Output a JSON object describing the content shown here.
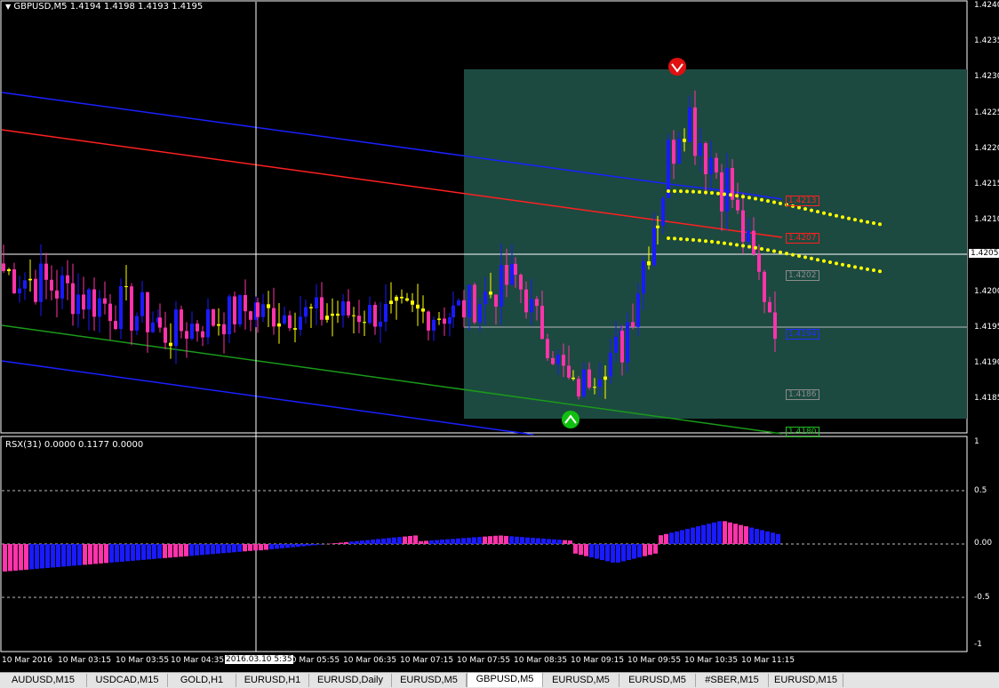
{
  "symbol_header": "GBPUSD,M5  1.4194 1.4198 1.4193 1.4195",
  "indicator_header": "RSX(31) 0.0000 0.1177 0.0000",
  "price_axis": [
    "1.4240",
    "1.4235",
    "1.4230",
    "1.4225",
    "1.4220",
    "1.4215",
    "1.4210",
    "1.4205",
    "1.4200",
    "1.4195",
    "1.4190",
    "1.4185"
  ],
  "current_price_label": "1.4205",
  "rsx_axis": [
    "1",
    "0.5",
    "0.00",
    "-0.5",
    "-1"
  ],
  "level_tags": [
    {
      "text": "1.4213",
      "color": "#ff2020"
    },
    {
      "text": "1.4207",
      "color": "#ff2020"
    },
    {
      "text": "1.4202",
      "color": "#8c8c8c"
    },
    {
      "text": "1.4194",
      "color": "#2030ff"
    },
    {
      "text": "1.4186",
      "color": "#8c8c8c"
    },
    {
      "text": "1.4180",
      "color": "#20c020"
    }
  ],
  "time_axis": [
    "10 Mar 2016",
    "10 Mar 03:15",
    "10 Mar 03:55",
    "10 Mar 04:35",
    "10 Mar 05:55",
    "10 Mar 06:35",
    "10 Mar 07:15",
    "10 Mar 07:55",
    "10 Mar 08:35",
    "10 Mar 09:15",
    "10 Mar 09:55",
    "10 Mar 10:35",
    "10 Mar 11:15"
  ],
  "time_cursor_label": "2016.03.10 5:35",
  "tabs": [
    "AUDUSD,M15",
    "USDCAD,M15",
    "GOLD,H1",
    "EURUSD,H1",
    "EURUSD,Daily",
    "EURUSD,M5",
    "GBPUSD,M5",
    "EURUSD,M5",
    "EURUSD,M5",
    "#SBER,M15",
    "EURUSD,M15"
  ],
  "active_tab": "GBPUSD,M5",
  "colors": {
    "bull": "#1a1aff",
    "bear": "#ff33aa",
    "doji": "#ffff00",
    "zone": "#1c4a40",
    "upper_channel": "#1a20ff",
    "mid_line": "#ff2020",
    "lower_ma": "#1a9a1a",
    "dots": "#ffff00"
  },
  "icons": {
    "sell_signal": "red-down-arrow-icon",
    "buy_signal": "green-up-arrow-icon",
    "dropdown": "triangle-down-icon"
  },
  "chart_data": {
    "type": "candlestick",
    "symbol": "GBPUSD",
    "timeframe": "M5",
    "ylim": [
      1.4181,
      1.424
    ],
    "rsx_ylim": [
      -1,
      1
    ]
  }
}
